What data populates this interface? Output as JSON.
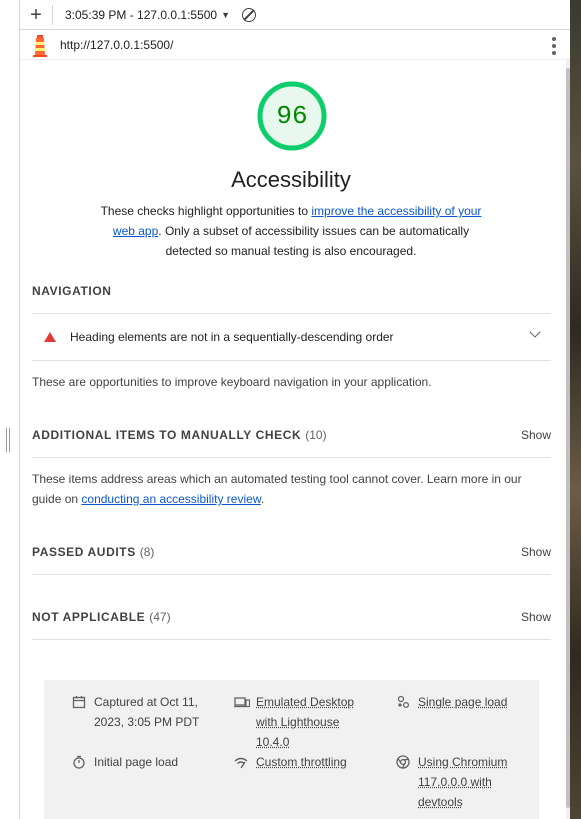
{
  "toolbar": {
    "add_label": "+",
    "report_time": "3:05:39 PM - 127.0.0.1:5500"
  },
  "urlbar": {
    "url": "http://127.0.0.1:5500/"
  },
  "category": {
    "score": "96",
    "title": "Accessibility",
    "desc_pre": "These checks highlight opportunities to ",
    "desc_link": "improve the accessibility of your web app",
    "desc_post": ". Only a subset of accessibility issues can be automatically detected so manual testing is also encouraged.",
    "score_color": "#0cce6b"
  },
  "groups": {
    "navigation": {
      "title": "NAVIGATION",
      "audit_title": "Heading elements are not in a sequentially-descending order",
      "desc": "These are opportunities to improve keyboard navigation in your application."
    },
    "manual": {
      "title": "ADDITIONAL ITEMS TO MANUALLY CHECK",
      "count": "(10)",
      "show": "Show",
      "desc_pre": "These items address areas which an automated testing tool cannot cover. Learn more in our guide on ",
      "desc_link": "conducting an accessibility review",
      "desc_post": "."
    },
    "passed": {
      "title": "PASSED AUDITS",
      "count": "(8)",
      "show": "Show"
    },
    "not_applicable": {
      "title": "NOT APPLICABLE",
      "count": "(47)",
      "show": "Show"
    }
  },
  "footer": {
    "captured": "Captured at Oct 11, 2023, 3:05 PM PDT",
    "emulated": "Emulated Desktop with Lighthouse 10.4.0",
    "single_page": "Single page load",
    "initial_load": "Initial page load",
    "throttling": "Custom throttling",
    "chromium": "Using Chromium 117.0.0.0 with devtools"
  }
}
